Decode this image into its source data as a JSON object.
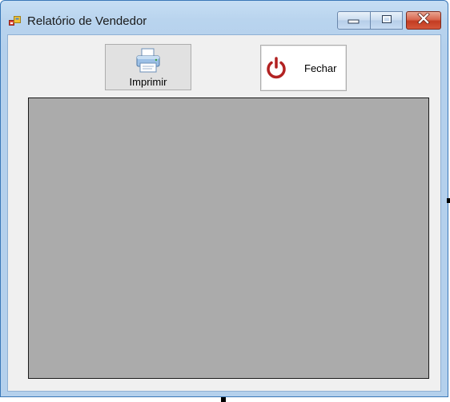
{
  "window": {
    "title": "Relatório de Vendedor",
    "icon": "app-window-icon",
    "caption_buttons": [
      "minimize-icon",
      "maximize-icon",
      "close-icon"
    ]
  },
  "toolbar": {
    "print_label": "Imprimir",
    "print_icon": "printer-icon",
    "close_label": "Fechar",
    "close_icon": "power-icon"
  },
  "colors": {
    "client_background": "#f0f0f0",
    "viewer_background": "#ababab",
    "power_icon": "#b22222",
    "close_caption_button": "#c9432a",
    "title_bar": "#b9d4ee"
  }
}
